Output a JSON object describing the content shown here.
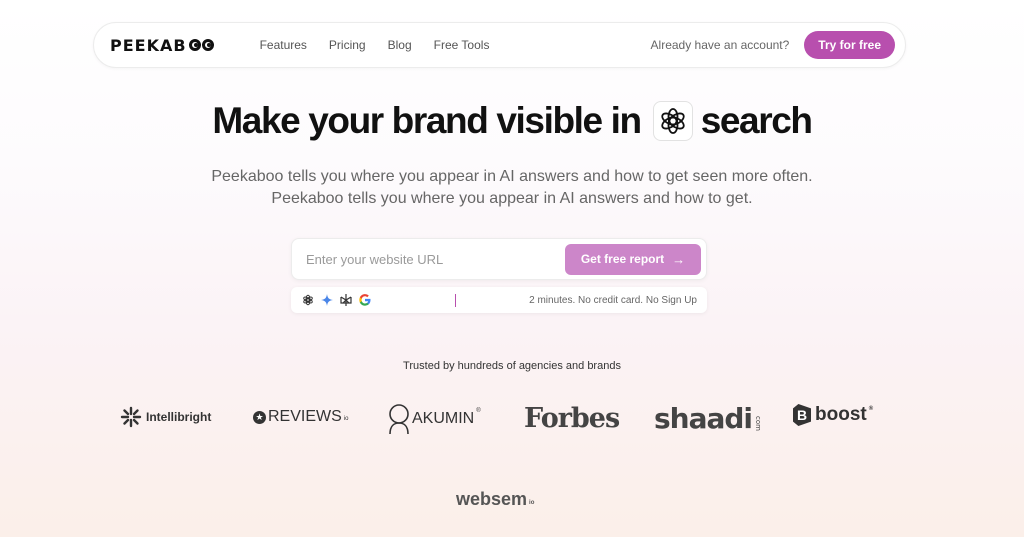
{
  "nav": {
    "logo": "PEEKAB",
    "links": [
      "Features",
      "Pricing",
      "Blog",
      "Free Tools"
    ],
    "login_text": "Already have an account?",
    "cta": "Try for free"
  },
  "hero": {
    "title_prefix": "Make your brand visible in",
    "title_suffix": "search",
    "ai_icon": "openai-icon",
    "subtitle_1": "Peekaboo tells you where you appear in AI answers and how to get seen more often.",
    "subtitle_2": "Peekaboo tells you where you appear in AI answers and how to get."
  },
  "form": {
    "placeholder": "Enter your website URL",
    "button": "Get free report",
    "button_icon": "arrow-right-icon",
    "engines": [
      "openai-icon",
      "gemini-icon",
      "perplexity-icon",
      "google-icon"
    ],
    "meta": "2 minutes. No credit card. No Sign Up"
  },
  "trusted": {
    "heading": "Trusted by hundreds of agencies and brands",
    "brands": [
      {
        "name": "Intellibright"
      },
      {
        "name": "REVIEWS",
        "suffix": "io"
      },
      {
        "name": "AKUMIN",
        "suffix": "®"
      },
      {
        "name": "Forbes"
      },
      {
        "name": "shaadi",
        "suffix": "com"
      },
      {
        "name": "boost",
        "suffix": "®"
      },
      {
        "name": "websem",
        "suffix": "io"
      }
    ]
  },
  "colors": {
    "accent": "#b84fae",
    "button_light": "#cc86c9"
  }
}
